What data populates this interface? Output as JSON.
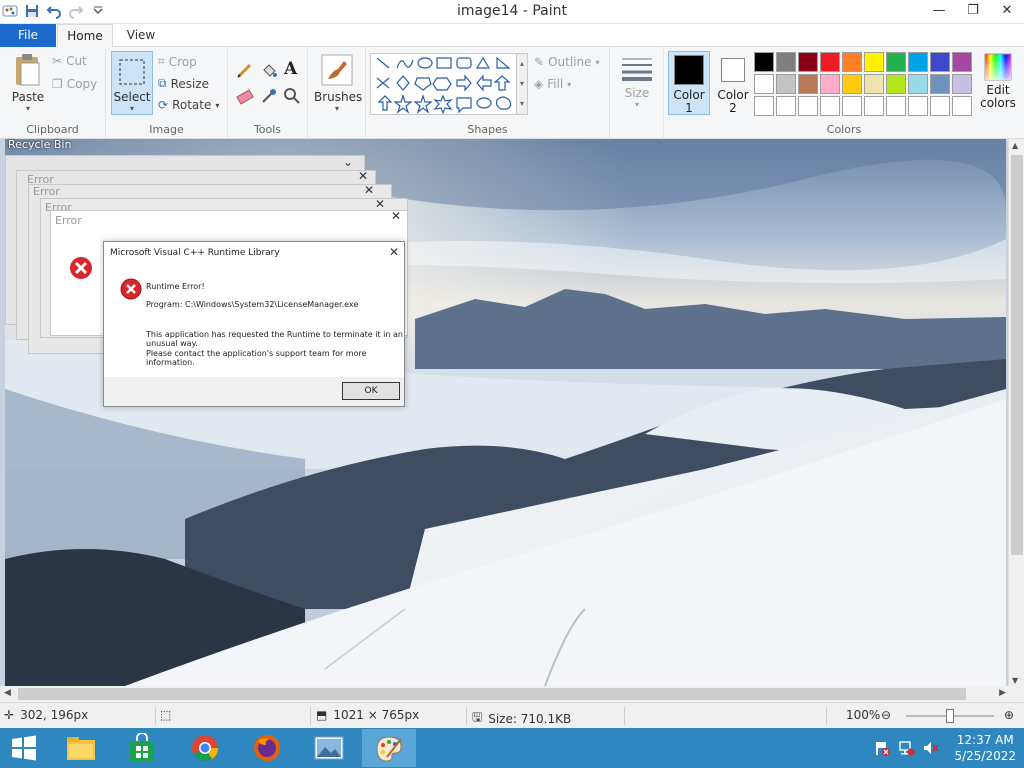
{
  "window": {
    "title": "image14 - Paint",
    "minimize": "—",
    "restore": "❐",
    "close": "✕"
  },
  "tabs": {
    "file": "File",
    "home": "Home",
    "view": "View"
  },
  "ribbon": {
    "clipboard": {
      "label": "Clipboard",
      "paste": "Paste",
      "cut": "Cut",
      "copy": "Copy"
    },
    "image": {
      "label": "Image",
      "select": "Select",
      "crop": "Crop",
      "resize": "Resize",
      "rotate": "Rotate"
    },
    "tools": {
      "label": "Tools"
    },
    "brushes": {
      "label": "Brushes"
    },
    "shapes": {
      "label": "Shapes",
      "outline": "Outline",
      "fill": "Fill"
    },
    "size": {
      "label": "Size"
    },
    "colors": {
      "label": "Colors",
      "color1": "Color",
      "color1_num": "1",
      "color2": "Color",
      "color2_num": "2",
      "edit_colors_1": "Edit",
      "edit_colors_2": "colors",
      "swatches": [
        "#000000",
        "#7f7f7f",
        "#880015",
        "#ed1c24",
        "#ff7f27",
        "#fff200",
        "#22b14c",
        "#00a2e8",
        "#3f48cc",
        "#a349a4",
        "#ffffff",
        "#c3c3c3",
        "#b97a57",
        "#ffaec9",
        "#ffc90e",
        "#efe4b0",
        "#b5e61d",
        "#99d9ea",
        "#7092be",
        "#c8bfe7",
        "#ffffff",
        "#ffffff",
        "#ffffff",
        "#ffffff",
        "#ffffff",
        "#ffffff",
        "#ffffff",
        "#ffffff",
        "#ffffff",
        "#ffffff"
      ]
    }
  },
  "desktop": {
    "recycle_bin": "Recycle Bin",
    "ghost_titles": [
      "Error",
      "Error",
      "Error",
      "Error"
    ]
  },
  "dialog": {
    "title": "Microsoft Visual C++ Runtime Library",
    "close": "✕",
    "heading": "Runtime Error!",
    "program": "Program: C:\\Windows\\System32\\LicenseManager.exe",
    "message1": "This application has requested the Runtime to terminate it in an",
    "message2": "unusual way.",
    "message3": "Please contact the application's support team for more information.",
    "ok": "OK"
  },
  "status": {
    "cursor": "302, 196px",
    "dimensions": "1021 × 765px",
    "size": "Size: 710.1KB",
    "zoom": "100%"
  },
  "tray": {
    "time": "12:37 AM",
    "date": "5/25/2022"
  }
}
